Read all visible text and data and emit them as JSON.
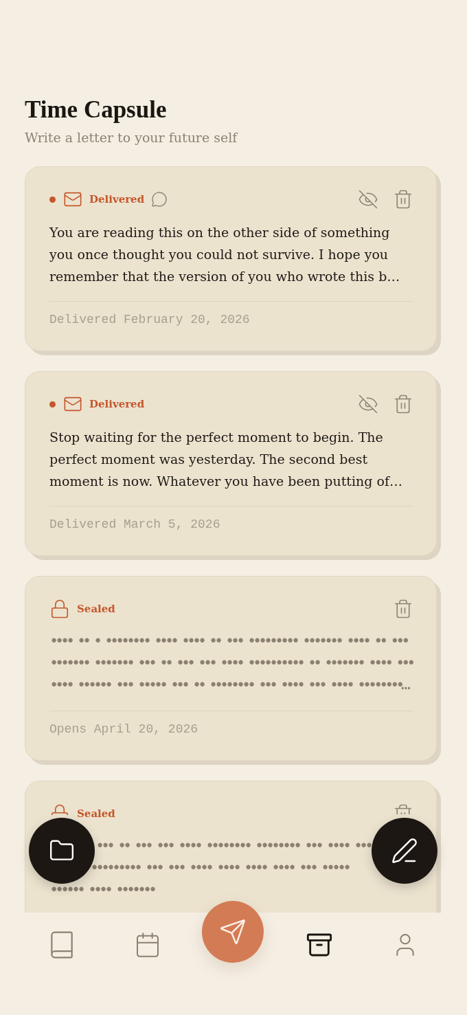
{
  "header": {
    "title": "Time Capsule",
    "subtitle": "Write a letter to your future self"
  },
  "letters": [
    {
      "kind": "delivered",
      "unread": true,
      "status": "Delivered",
      "comment": true,
      "preview": "You are reading this on the other side of something you once thought you could not survive. I hope you remember that the version of you who wrote this b…",
      "footer": "Delivered February 20, 2026"
    },
    {
      "kind": "delivered",
      "unread": true,
      "status": "Delivered",
      "comment": false,
      "preview": "Stop waiting for the perfect moment to begin. The perfect moment was yesterday. The second best moment is now. Whatever you have been putting of…",
      "footer": "Delivered March 5, 2026"
    },
    {
      "kind": "sealed",
      "status": "Sealed",
      "preview": "•••• •• • •••••••• •••• •••• •• ••• ••••••••• ••••••• •••• •• ••• ••••••• ••••••• ••• •• ••• ••• •••• •••••••••• •• ••••••• •••• ••• •••• •••••• ••• ••••• ••• •• •••••••• ••• •••• ••• •••• ••••••••…",
      "footer": "Opens April 20, 2026"
    },
    {
      "kind": "sealed",
      "status": "Sealed",
      "preview_lines": [
        "••• •• ••• ••• •••• •••••••• •••••••• ••• •••• •••",
        "••••••••• ••• ••• •••• •••• •••• •••• ••• •••••",
        "•••••• •••• •••••••"
      ]
    }
  ],
  "nav": {
    "items": [
      {
        "selected": false
      },
      {
        "selected": false
      },
      {
        "selected": true
      },
      {
        "selected": false
      }
    ]
  }
}
